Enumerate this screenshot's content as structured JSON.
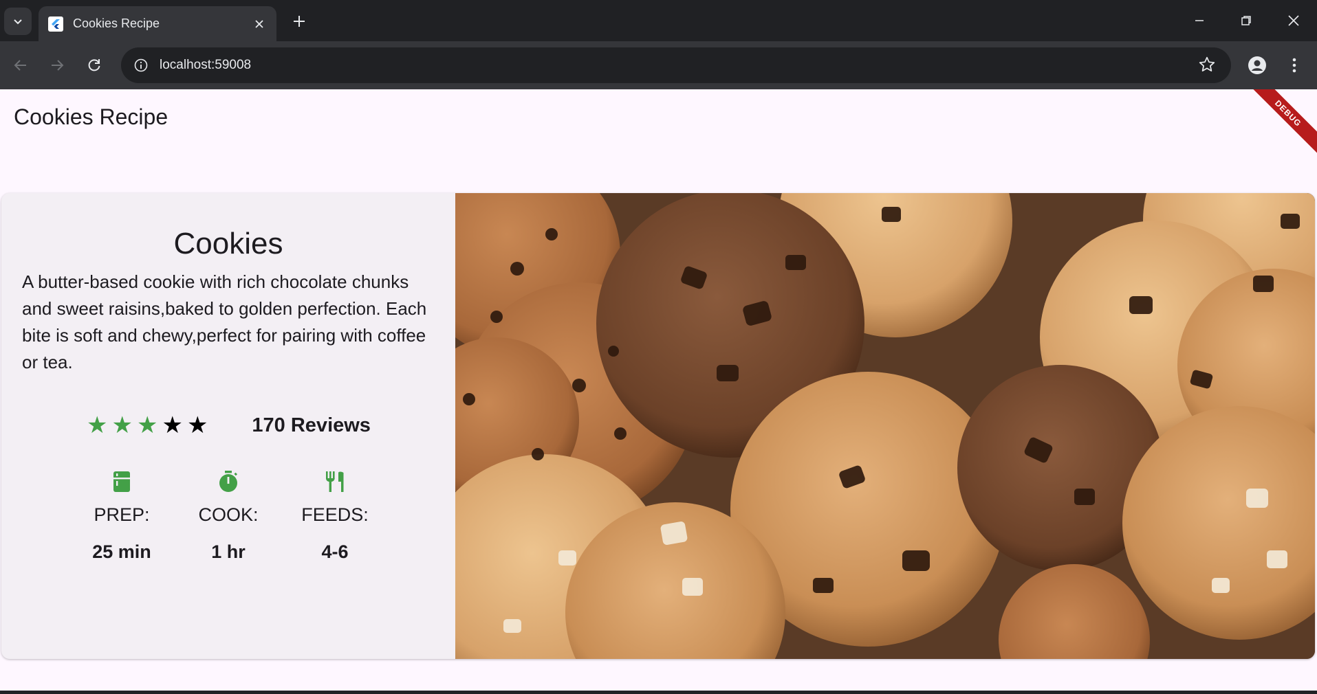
{
  "browser": {
    "tab_title": "Cookies Recipe",
    "url": "localhost:59008"
  },
  "app": {
    "title": "Cookies Recipe",
    "debug_banner": "DEBUG"
  },
  "recipe": {
    "name": "Cookies",
    "description": "A butter-based cookie with rich chocolate chunks and sweet raisins,baked to golden perfection. Each bite is soft and chewy,perfect for pairing with coffee or tea.",
    "rating": {
      "filled": 3,
      "total": 5,
      "filled_color": "#43a047",
      "empty_color": "#000000"
    },
    "reviews": "170 Reviews",
    "facts": [
      {
        "icon": "kitchen-icon",
        "label": "PREP:",
        "value": "25 min"
      },
      {
        "icon": "timer-icon",
        "label": "COOK:",
        "value": "1 hr"
      },
      {
        "icon": "restaurant-icon",
        "label": "FEEDS:",
        "value": "4-6"
      }
    ]
  },
  "colors": {
    "accent": "#43a047",
    "page_bg": "#fef7ff",
    "card_bg": "#f3eff4"
  }
}
